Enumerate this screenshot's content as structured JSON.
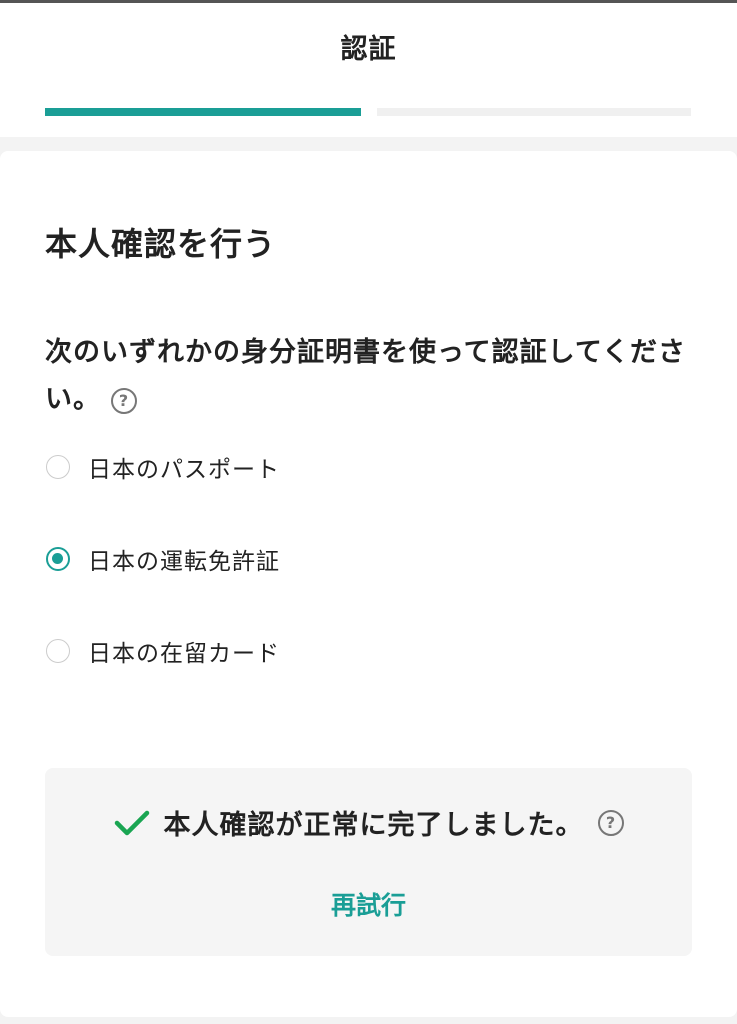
{
  "header": {
    "title": "認証",
    "progress_step": 1,
    "progress_total": 2
  },
  "main": {
    "title": "本人確認を行う",
    "instruction": "次のいずれかの身分証明書を使って認証してください。",
    "help_icon": "question-circle-icon",
    "options": [
      {
        "label": "日本のパスポート",
        "selected": false
      },
      {
        "label": "日本の運転免許証",
        "selected": true
      },
      {
        "label": "日本の在留カード",
        "selected": false
      }
    ],
    "status": {
      "icon": "checkmark-icon",
      "message": "本人確認が正常に完了しました。",
      "retry_label": "再試行"
    }
  },
  "colors": {
    "accent": "#1a9e96",
    "success": "#1aa552",
    "progress_inactive": "#f0f0f0",
    "page_bg": "#f3f3f3"
  }
}
